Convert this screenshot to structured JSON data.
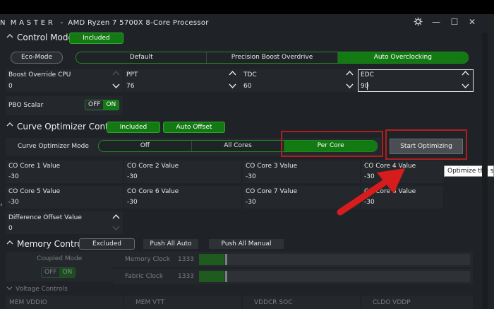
{
  "window": {
    "title": "N  M A S T E R   -  AMD Ryzen 7 5700X 8-Core Processor",
    "controls": {
      "settings_icon": "gear-icon",
      "minimize": "—",
      "maximize": "☐",
      "close": "✕"
    }
  },
  "control_mode": {
    "title": "Control Mode",
    "badge": "Included",
    "eco_mode": "Eco-Mode",
    "modes": [
      "Default",
      "Precision Boost Overdrive",
      "Auto Overclocking"
    ],
    "selected_mode": "Auto Overclocking",
    "fields": [
      {
        "label": "Boost Override CPU",
        "value": "0"
      },
      {
        "label": "PPT",
        "value": "76"
      },
      {
        "label": "TDC",
        "value": "60"
      },
      {
        "label": "EDC",
        "value": "90"
      }
    ],
    "pbo_scalar": {
      "label": "PBO Scalar",
      "off": "OFF",
      "on": "ON"
    }
  },
  "curve_optimizer": {
    "title": "Curve Optimizer Control",
    "badge_included": "Included",
    "badge_auto_offset": "Auto Offset",
    "mode_label": "Curve Optimizer Mode",
    "modes": [
      "Off",
      "All Cores",
      "Per Core"
    ],
    "selected_mode": "Per Core",
    "start_button": "Start Optimizing",
    "tooltip": "Optimize the sys",
    "cores": [
      {
        "label": "CO Core 1 Value",
        "value": "-30"
      },
      {
        "label": "CO Core 2 Value",
        "value": "-30"
      },
      {
        "label": "CO Core 3 Value",
        "value": "-30"
      },
      {
        "label": "CO Core 4 Value",
        "value": "-30"
      },
      {
        "label": "CO Core 5 Value",
        "value": "-30"
      },
      {
        "label": "CO Core 6 Value",
        "value": "-30"
      },
      {
        "label": "CO Core 7 Value",
        "value": "-30"
      },
      {
        "label": "CO Core 8 Value",
        "value": "-30"
      }
    ],
    "difference_offset": {
      "label": "Difference Offset Value",
      "value": "0"
    }
  },
  "memory_control": {
    "title": "Memory Control",
    "badge": "Excluded",
    "push_all_auto": "Push All Auto",
    "push_all_manual": "Push All Manual",
    "coupled_mode": {
      "label": "Coupled Mode",
      "off": "OFF",
      "on": "ON"
    },
    "memory_clock": {
      "label": "Memory Clock",
      "value": "1333"
    },
    "fabric_clock": {
      "label": "Fabric Clock",
      "value": "1333"
    }
  },
  "voltage_controls": {
    "title": "Voltage Controls",
    "items": [
      "MEM VDDIO",
      "MEM VTT",
      "VDDCR SOC",
      "CLDO VDDP"
    ]
  },
  "colors": {
    "accent_green": "#137a13",
    "highlight_red": "#b01e1e",
    "background": "#1f2327"
  }
}
